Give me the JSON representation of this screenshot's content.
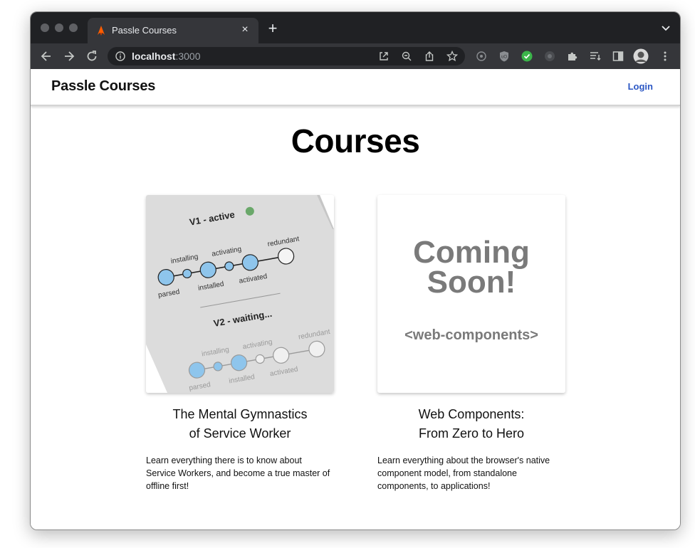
{
  "browser": {
    "tab": {
      "title": "Passle Courses",
      "close_label": "×"
    },
    "new_tab_label": "+",
    "address": {
      "host": "localhost",
      "port": ":3000"
    }
  },
  "site": {
    "brand": "Passle Courses",
    "login_label": "Login",
    "page_title": "Courses"
  },
  "courses": [
    {
      "title_line1": "The Mental Gymnastics",
      "title_line2": "of Service Worker",
      "description": "Learn everything there is to know about Service Workers, and become a true master of offline first!",
      "image": {
        "v1_label": "V1 - active",
        "v2_label": "V2 - waiting...",
        "states": [
          "parsed",
          "installing",
          "installed",
          "activating",
          "activated",
          "redundant"
        ]
      }
    },
    {
      "title_line1": "Web Components:",
      "title_line2": "From Zero to Hero",
      "description": "Learn everything about the browser's native component model, from standalone components, to applications!",
      "image": {
        "coming_line1": "Coming",
        "coming_line2": "Soon!",
        "tag": "<web-components>"
      }
    }
  ],
  "colors": {
    "accent": "#2b57c4",
    "node_fill": "#8ec5ec",
    "coming_soon": "#7a7a7a"
  },
  "icons": [
    "back-arrow-icon",
    "forward-arrow-icon",
    "reload-icon",
    "info-icon",
    "open-external-icon",
    "zoom-out-icon",
    "share-icon",
    "bookmark-star-icon",
    "extensions-puzzle-icon",
    "reading-list-icon",
    "side-panel-icon",
    "profile-avatar-icon",
    "menu-dots-icon"
  ]
}
